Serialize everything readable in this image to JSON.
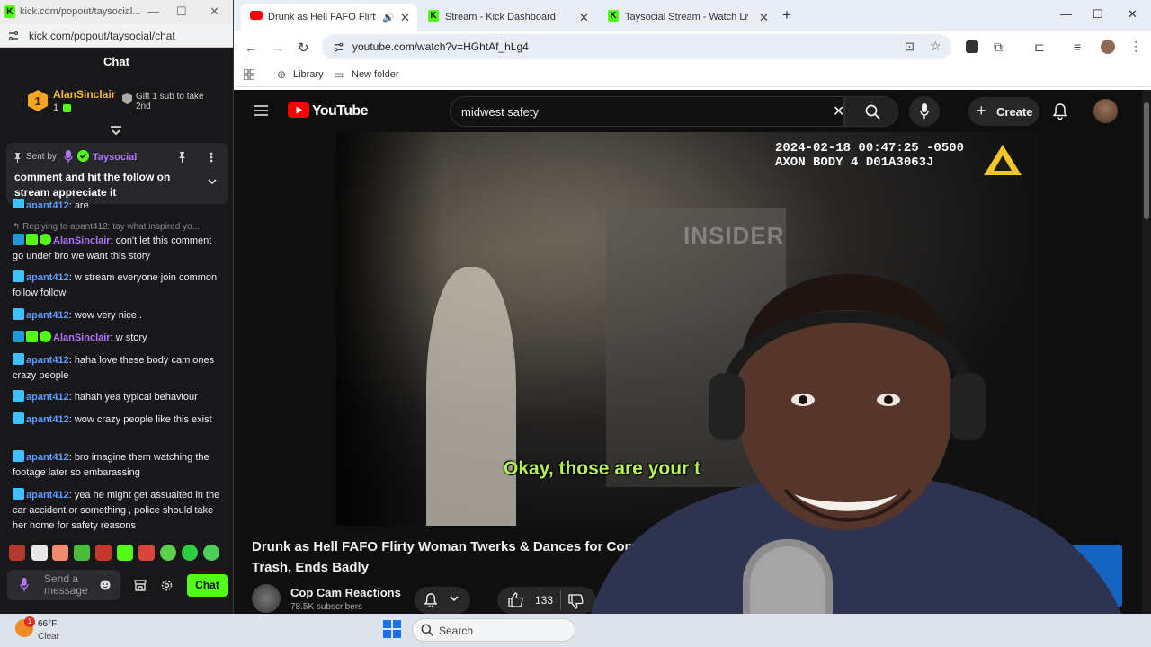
{
  "popup": {
    "title": "kick.com/popout/taysocial...",
    "url": "kick.com/popout/taysocial/chat",
    "chat_header": "Chat"
  },
  "leaderboard": {
    "rank": "1",
    "user": "AlanSinclair",
    "count": "1",
    "gift_text": "Gift 1 sub to take 2nd"
  },
  "pinned": {
    "sent_by_label": "Sent by",
    "sender": "Taysocial",
    "message": "comment and hit the follow on stream appreciate it"
  },
  "chat": {
    "partial_top": {
      "user": "apant412",
      "text": ": are"
    },
    "reply_line": "Replying to apant412: tay what inspired yo...",
    "messages": [
      {
        "user": "AlanSinclair",
        "color": "purple",
        "text": ": don't let this comment go under bro we want this story"
      },
      {
        "user": "apant412",
        "color": "blue",
        "text": ": w stream everyone join common follow follow"
      },
      {
        "user": "apant412",
        "color": "blue",
        "text": ": wow very nice ."
      },
      {
        "user": "AlanSinclair",
        "color": "purple",
        "text": ": w story"
      },
      {
        "user": "apant412",
        "color": "blue",
        "text": ": haha love these body cam ones crazy people"
      },
      {
        "user": "apant412",
        "color": "blue",
        "text": ": hahah yea typical behaviour"
      },
      {
        "user": "apant412",
        "color": "blue",
        "text": ": wow crazy people like this exist"
      },
      {
        "user": "apant412",
        "color": "blue",
        "text": ": bro imagine them watching the footage later so embarassing"
      },
      {
        "user": "apant412",
        "color": "blue",
        "text": ": yea he might get assualted in the car accident or something , police should take her home for safety reasons"
      }
    ],
    "input_placeholder": "Send a message",
    "chat_button": "Chat"
  },
  "browser": {
    "tabs": [
      {
        "label": "Drunk as Hell FAFO Flirty W",
        "active": true
      },
      {
        "label": "Stream - Kick Dashboard",
        "active": false
      },
      {
        "label": "Taysocial Stream - Watch Live o",
        "active": false
      }
    ],
    "url": "youtube.com/watch?v=HGhtAf_hLg4",
    "bookmarks": [
      "Library",
      "New folder"
    ]
  },
  "youtube": {
    "logo_text": "YouTube",
    "search_query": "midwest safety",
    "create_label": "Create",
    "video": {
      "timestamp": "2024-02-18 00:47:25 -0500",
      "camera": "AXON BODY 4 D01A3063J",
      "watermark": "INSIDER",
      "subtitle": "Okay, those are your t"
    },
    "title": "Drunk as Hell FAFO Flirty Woman Twerks & Dances for Cops, Tr... Trash, Ends Badly",
    "title_line1": "Drunk as Hell FAFO Flirty Woman Twerks & Dances for Cops, Tr",
    "title_line2": "Trash, Ends Badly",
    "channel": "Cop Cam Reactions",
    "subscribers": "78.5K subscribers",
    "likes": "133"
  },
  "taskbar": {
    "temp": "66°F",
    "condition": "Clear",
    "weather_badge": "1",
    "search_placeholder": "Search"
  },
  "colors": {
    "kick_green": "#53fc18",
    "yt_red": "#ff0000",
    "subtitle_green": "#b8f05a"
  }
}
